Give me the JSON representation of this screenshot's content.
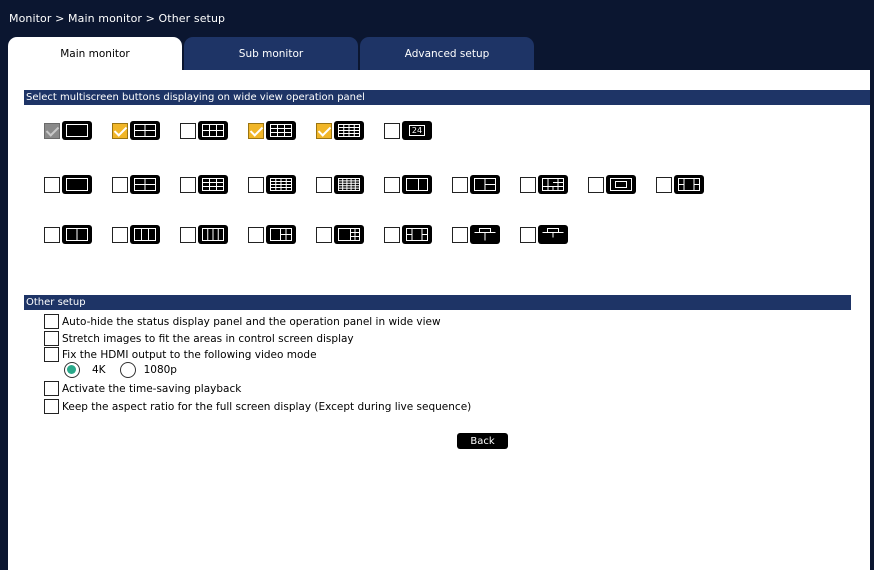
{
  "breadcrumb": "Monitor > Main monitor > Other setup",
  "tabs": [
    {
      "label": "Main monitor",
      "active": true
    },
    {
      "label": "Sub monitor",
      "active": false
    },
    {
      "label": "Advanced setup",
      "active": false
    }
  ],
  "multiscreen_section": {
    "title": "Select multiscreen buttons displaying on wide view operation panel",
    "rows": [
      [
        {
          "icon": "single-screen-icon",
          "checked": true,
          "disabled": true
        },
        {
          "icon": "quad-screen-icon",
          "checked": true
        },
        {
          "icon": "6-split-screen-icon",
          "checked": false
        },
        {
          "icon": "9-split-screen-icon",
          "checked": true
        },
        {
          "icon": "16-split-screen-icon",
          "checked": true
        },
        {
          "icon": "24-split-screen-icon",
          "checked": false,
          "label": "24"
        }
      ],
      [
        {
          "icon": "single-screen-icon",
          "checked": false
        },
        {
          "icon": "quad-screen-icon",
          "checked": false
        },
        {
          "icon": "9-split-screen-icon",
          "checked": false
        },
        {
          "icon": "16-split-screen-icon",
          "checked": false
        },
        {
          "icon": "25-split-screen-icon",
          "checked": false
        },
        {
          "icon": "2-split-right-icon",
          "checked": false
        },
        {
          "icon": "3-split-bottom-icon",
          "checked": false
        },
        {
          "icon": "corner-split-icon",
          "checked": false
        },
        {
          "icon": "frame-split-icon",
          "checked": false
        },
        {
          "icon": "side-split-icon",
          "checked": false
        }
      ],
      [
        {
          "icon": "2-split-horizontal-icon",
          "checked": false
        },
        {
          "icon": "3-split-vertical-icon",
          "checked": false
        },
        {
          "icon": "4-split-vertical-icon",
          "checked": false
        },
        {
          "icon": "1-plus-3-split-icon",
          "checked": false
        },
        {
          "icon": "1-plus-4-split-icon",
          "checked": false
        },
        {
          "icon": "center-focus-split-icon",
          "checked": false
        },
        {
          "icon": "top-plus-bottom-split-icon",
          "checked": false
        },
        {
          "icon": "top-plus-bottom-small-split-icon",
          "checked": false
        }
      ]
    ]
  },
  "other_setup": {
    "title": "Other setup",
    "options": [
      {
        "label": "Auto-hide the status display panel and the operation panel in wide view",
        "checked": false
      },
      {
        "label": "Stretch images to fit the areas in control screen display",
        "checked": false
      },
      {
        "label": "Fix the HDMI output to the following video mode",
        "checked": false
      },
      {
        "label": "Activate the time-saving playback",
        "checked": false
      },
      {
        "label": "Keep the aspect ratio for the full screen display (Except during live sequence)",
        "checked": false
      }
    ],
    "video_modes": [
      {
        "label": "4K",
        "selected": true
      },
      {
        "label": "1080p",
        "selected": false
      }
    ]
  },
  "back_label": "Back",
  "colors": {
    "background": "#0b1630",
    "section_bar": "#1e3466",
    "check_accent": "#f1b628",
    "radio_accent": "#29a98a"
  }
}
